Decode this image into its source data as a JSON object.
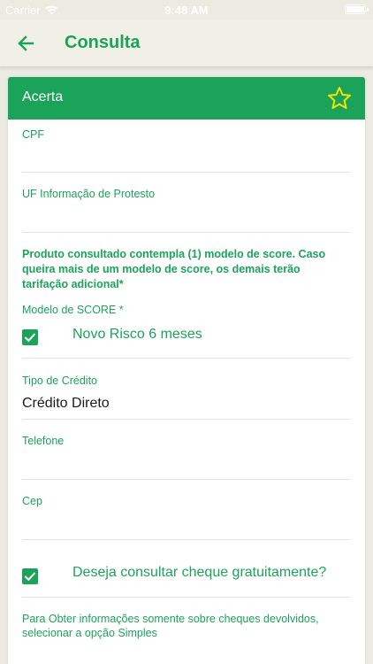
{
  "status_bar": {
    "carrier": "Carrier",
    "time": "9:48 AM",
    "icons": [
      "wifi-icon",
      "battery-icon"
    ]
  },
  "nav": {
    "back_icon": "arrow-left-icon",
    "title": "Consulta"
  },
  "card": {
    "title": "Acerta",
    "favorite_icon": "star-outline-icon",
    "fields": {
      "cpf": {
        "label": "CPF",
        "value": ""
      },
      "uf": {
        "label": "UF Informação de Protesto",
        "value": ""
      },
      "tipo_credito": {
        "label": "Tipo de Crédito",
        "value": "Crédito Direto"
      },
      "telefone": {
        "label": "Telefone",
        "value": ""
      },
      "cep": {
        "label": "Cep",
        "value": ""
      }
    },
    "notice": "Produto consultado contempla (1) modelo de score. Caso queira mais de um modelo de score, os demais terão tarifação adicional*",
    "score": {
      "label": "Modelo de SCORE *",
      "option_label": "Novo Risco 6 meses",
      "checked": true
    },
    "cheque": {
      "label": "Deseja consultar cheque gratuitamente?",
      "checked": true
    },
    "hint": "Para Obter informações somente sobre cheques devolvidos, selecionar a opção Simples"
  },
  "colors": {
    "primary": "#1ba35a",
    "background": "#ebebe2",
    "nav_background": "#f0f0e6",
    "star": "#f2e600"
  }
}
